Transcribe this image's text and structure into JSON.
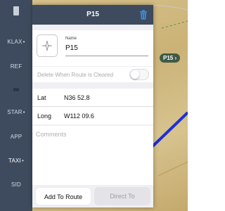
{
  "sidebar": {
    "items": [
      {
        "label": "KLAX",
        "dot": "•"
      },
      {
        "label": "REF",
        "dot": ""
      },
      {
        "label": "∞",
        "dot": ""
      },
      {
        "label": "STAR",
        "dot": "•"
      },
      {
        "label": "APP",
        "dot": ""
      },
      {
        "label": "TAXI",
        "dot": "•"
      },
      {
        "label": "SID",
        "dot": ""
      }
    ]
  },
  "dialog": {
    "title": "P15",
    "name_label": "Name",
    "name_value": "P15",
    "delete_label": "Delete When Route is Cleared",
    "delete_toggle_on": false,
    "lat_label": "Lat",
    "lat_value": "N36 52.8",
    "long_label": "Long",
    "long_value": "W112 09.6",
    "comments_placeholder": "Comments",
    "add_to_route_label": "Add To Route",
    "direct_to_label": "Direct To"
  },
  "map": {
    "waypoint_label": "P15 ›",
    "route_color": "#1d2fd6"
  },
  "colors": {
    "header": "#3e4b5e",
    "accent": "#3b8fe0"
  }
}
